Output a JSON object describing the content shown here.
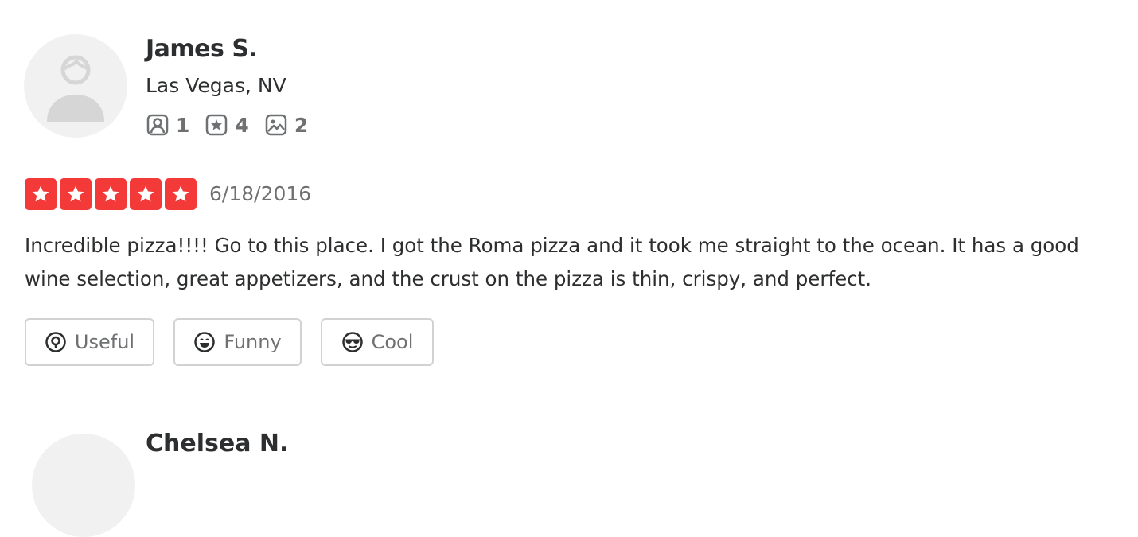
{
  "review": {
    "user": {
      "avatar_icon": "default-user-avatar-icon",
      "name": "James S.",
      "location": "Las Vegas, NV",
      "stats": {
        "friends": {
          "icon": "friends-icon",
          "value": "1"
        },
        "reviews": {
          "icon": "review-star-icon",
          "value": "4"
        },
        "photos": {
          "icon": "photo-icon",
          "value": "2"
        }
      }
    },
    "rating": 5,
    "rating_color": "#f43939",
    "date": "6/18/2016",
    "text": "Incredible pizza!!!! Go to this place. I got the Roma pizza and it took me straight to the ocean. It has a good wine selection, great appetizers, and the crust on the pizza is thin, crispy, and perfect.",
    "reactions": [
      {
        "label": "Useful",
        "icon": "useful-icon"
      },
      {
        "label": "Funny",
        "icon": "funny-face-icon"
      },
      {
        "label": "Cool",
        "icon": "cool-sunglasses-icon"
      }
    ]
  },
  "next_review": {
    "name": "Chelsea N."
  }
}
